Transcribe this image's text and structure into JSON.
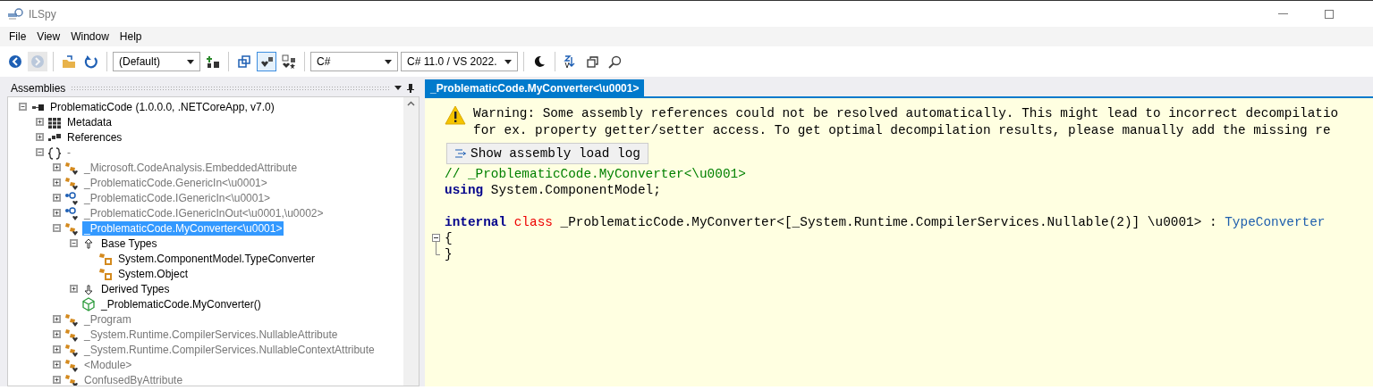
{
  "window": {
    "title": "ILSpy"
  },
  "menu": [
    "File",
    "View",
    "Window",
    "Help"
  ],
  "toolbar": [
    {
      "kind": "button",
      "pressed": false,
      "disabled": false
    },
    {
      "kind": "button",
      "pressed": false,
      "disabled": true
    },
    {
      "kind": "separator"
    },
    {
      "kind": "button",
      "pressed": false,
      "disabled": false
    },
    {
      "kind": "button",
      "pressed": false,
      "disabled": false
    },
    {
      "kind": "separator"
    },
    {
      "kind": "dropdown",
      "value": "(Default)",
      "wide": true
    },
    {
      "kind": "button",
      "pressed": false,
      "disabled": false
    },
    {
      "kind": "separator"
    },
    {
      "kind": "button",
      "pressed": false,
      "disabled": false
    },
    {
      "kind": "button",
      "pressed": true,
      "disabled": false
    },
    {
      "kind": "button",
      "pressed": false,
      "disabled": false
    },
    {
      "kind": "separator"
    },
    {
      "kind": "dropdown",
      "value": "C#",
      "wide": true
    },
    {
      "kind": "dropdown",
      "value": "C# 11.0 / VS 2022.",
      "wide": false
    },
    {
      "kind": "separator"
    },
    {
      "kind": "button",
      "pressed": false,
      "disabled": false
    },
    {
      "kind": "separator"
    },
    {
      "kind": "button",
      "pressed": false,
      "disabled": false
    },
    {
      "kind": "button",
      "pressed": false,
      "disabled": false
    },
    {
      "kind": "button",
      "pressed": false,
      "disabled": false
    }
  ],
  "assemblies_pane": {
    "title": "Assemblies",
    "tree": [
      {
        "kind": "assembly",
        "label": "ProblematicCode (1.0.0.0, .NETCoreApp, v7.0)",
        "dimmed": false,
        "selected": false,
        "expanded": true,
        "children": [
          {
            "kind": "metadata",
            "label": "Metadata",
            "dimmed": false,
            "selected": false,
            "expanded": false
          },
          {
            "kind": "references",
            "label": "References",
            "dimmed": false,
            "selected": false,
            "expanded": false
          },
          {
            "kind": "namespace",
            "label": "-",
            "dimmed": true,
            "selected": false,
            "expanded": true,
            "children": [
              {
                "kind": "class",
                "label": "_Microsoft.CodeAnalysis.EmbeddedAttribute",
                "dimmed": true,
                "selected": false,
                "expanded": false
              },
              {
                "kind": "class",
                "label": "_ProblematicCode.GenericIn<\\u0001>",
                "dimmed": true,
                "selected": false,
                "expanded": false
              },
              {
                "kind": "interface",
                "label": "_ProblematicCode.IGenericIn<\\u0001>",
                "dimmed": true,
                "selected": false,
                "expanded": false
              },
              {
                "kind": "interface",
                "label": "_ProblematicCode.IGenericInOut<\\u0001,\\u0002>",
                "dimmed": true,
                "selected": false,
                "expanded": false
              },
              {
                "kind": "class",
                "label": "_ProblematicCode.MyConverter<\\u0001>",
                "dimmed": true,
                "selected": true,
                "expanded": true,
                "children": [
                  {
                    "kind": "base-types",
                    "label": "Base Types",
                    "dimmed": false,
                    "selected": false,
                    "expanded": true,
                    "children": [
                      {
                        "kind": "base-class",
                        "label": "System.ComponentModel.TypeConverter",
                        "dimmed": false,
                        "selected": false
                      },
                      {
                        "kind": "base-class",
                        "label": "System.Object",
                        "dimmed": false,
                        "selected": false
                      }
                    ]
                  },
                  {
                    "kind": "derived-types",
                    "label": "Derived Types",
                    "dimmed": false,
                    "selected": false,
                    "expanded": false
                  },
                  {
                    "kind": "method",
                    "label": "_ProblematicCode.MyConverter()",
                    "dimmed": false,
                    "selected": false
                  }
                ]
              },
              {
                "kind": "class",
                "label": "_Program",
                "dimmed": true,
                "selected": false,
                "expanded": false
              },
              {
                "kind": "class",
                "label": "_System.Runtime.CompilerServices.NullableAttribute",
                "dimmed": true,
                "selected": false,
                "expanded": false
              },
              {
                "kind": "class",
                "label": "_System.Runtime.CompilerServices.NullableContextAttribute",
                "dimmed": true,
                "selected": false,
                "expanded": false
              },
              {
                "kind": "class",
                "label": "<Module>",
                "dimmed": true,
                "selected": false,
                "expanded": false
              },
              {
                "kind": "class",
                "label": "ConfusedByAttribute",
                "dimmed": true,
                "selected": false,
                "expanded": false
              }
            ]
          }
        ]
      }
    ]
  },
  "tabs": [
    {
      "label": "_ProblematicCode.MyConverter<\\u0001>",
      "selected": true
    }
  ],
  "warning": {
    "lines": [
      "Warning: Some assembly references could not be resolved automatically. This might lead to incorrect decompilatio",
      "for ex. property getter/setter access. To get optimal decompilation results, please manually add the missing re"
    ],
    "button": "Show assembly load log"
  },
  "code": [
    {
      "segments": [
        {
          "kind": "comment",
          "text": "// _ProblematicCode.MyConverter<\\u0001>"
        }
      ]
    },
    {
      "segments": [
        {
          "kind": "keyword",
          "text": "using"
        },
        {
          "kind": "plain",
          "text": " System.ComponentModel;"
        }
      ]
    },
    {
      "gap_before": true,
      "segments": [
        {
          "kind": "keyword",
          "text": "internal"
        },
        {
          "kind": "modifier",
          "text": "class"
        },
        {
          "kind": "plain",
          "text": " _ProblematicCode.MyConverter<[_System.Runtime.CompilerServices.Nullable(2)] \\u0001> : "
        },
        {
          "kind": "type",
          "text": "TypeConverter"
        }
      ]
    },
    {
      "fold_start": true,
      "segments": [
        {
          "kind": "plain",
          "text": "{"
        }
      ]
    },
    {
      "fold_end": true,
      "segments": [
        {
          "kind": "plain",
          "text": "}"
        }
      ]
    }
  ]
}
